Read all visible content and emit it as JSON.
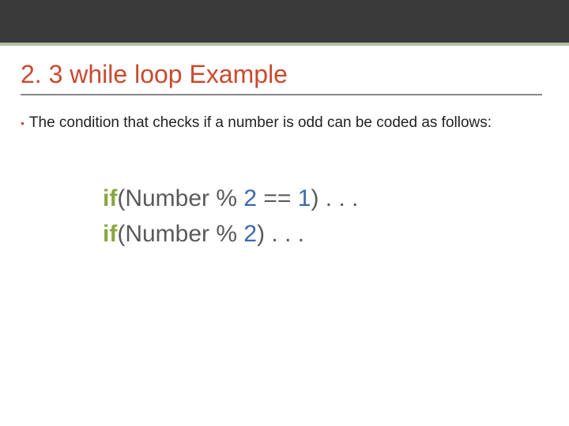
{
  "title": "2. 3 while loop  Example",
  "bullet": {
    "text": "The condition that checks if a number is odd can be coded as follows:"
  },
  "code": {
    "line1": {
      "kw": "if",
      "open": "(",
      "expr": "Number % ",
      "two": "2",
      "rest": " == ",
      "one": "1",
      "close": ")",
      "dots": " . . ."
    },
    "line2": {
      "kw": "if",
      "open": "(",
      "expr": "Number % ",
      "two": "2",
      "close": ")",
      "dots": " . . ."
    }
  }
}
